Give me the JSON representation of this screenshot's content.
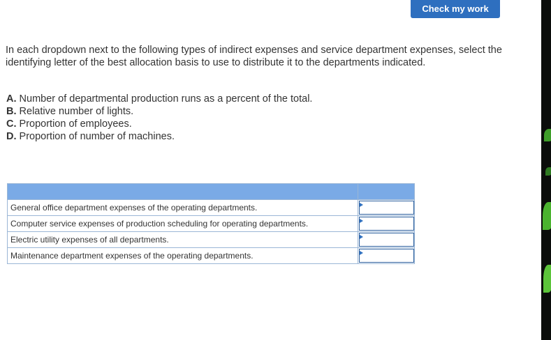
{
  "toolbar": {
    "check_label": "Check my work"
  },
  "instructions": "In each dropdown next to the following types of indirect expenses and service department expenses, select the identifying letter of the best allocation basis to use to distribute it to the departments indicated.",
  "options": [
    {
      "letter": "A.",
      "text": "Number of departmental production runs as a percent of the total."
    },
    {
      "letter": "B.",
      "text": "Relative number of lights."
    },
    {
      "letter": "C.",
      "text": "Proportion of employees."
    },
    {
      "letter": "D.",
      "text": "Proportion of number of machines."
    }
  ],
  "table": {
    "headers": [
      "",
      ""
    ],
    "rows": [
      {
        "label": "General office department expenses of the operating departments.",
        "selected": ""
      },
      {
        "label": "Computer service expenses of production scheduling for operating departments.",
        "selected": ""
      },
      {
        "label": "Electric utility expenses of all departments.",
        "selected": ""
      },
      {
        "label": "Maintenance department expenses of the operating departments.",
        "selected": ""
      }
    ]
  },
  "colors": {
    "accent": "#2e6fbf",
    "table_header": "#7aaae6",
    "border": "#9ab6d6"
  }
}
